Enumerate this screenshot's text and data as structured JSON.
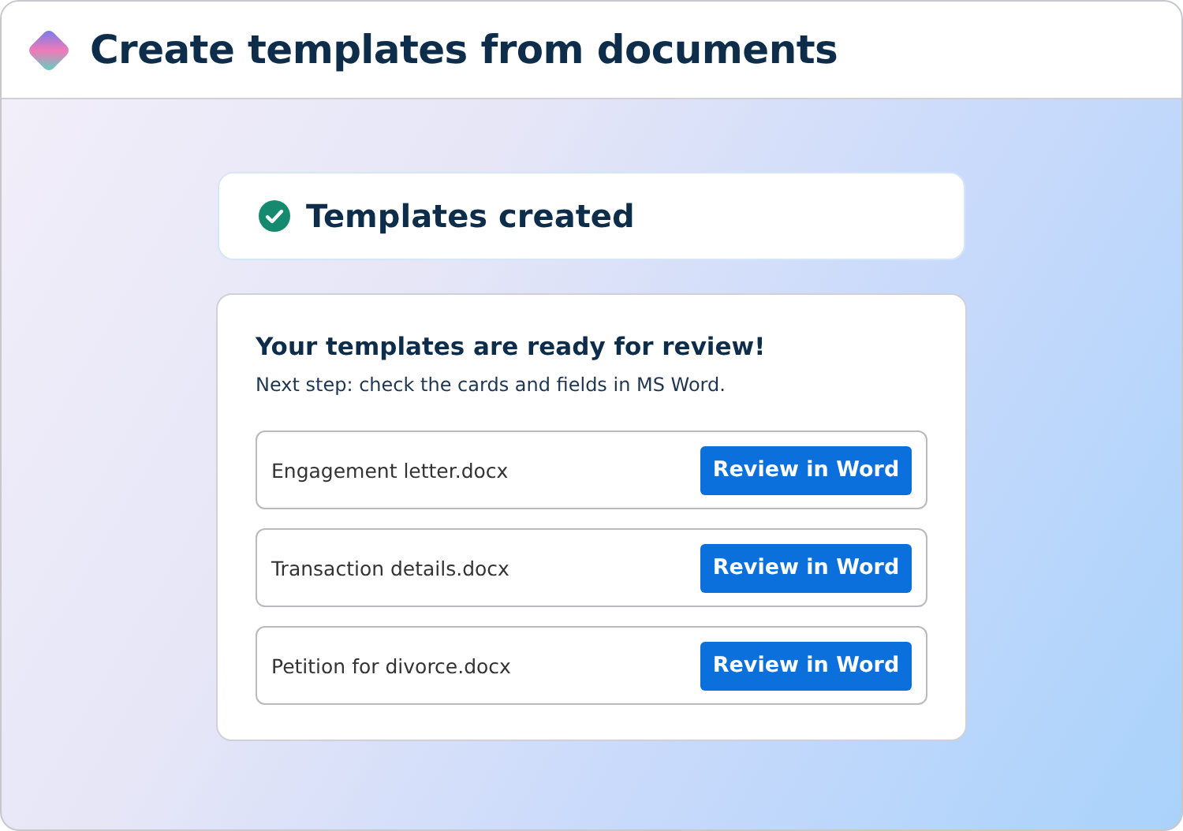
{
  "header": {
    "title": "Create templates from documents"
  },
  "status": {
    "title": "Templates created",
    "done": true
  },
  "panel": {
    "heading": "Your templates are ready for review!",
    "subtitle": "Next step: check the cards and fields in MS Word.",
    "files": [
      {
        "name": "Engagement letter.docx",
        "action": "Review in Word"
      },
      {
        "name": "Transaction details.docx",
        "action": "Review in Word"
      },
      {
        "name": "Petition for divorce.docx",
        "action": "Review in Word"
      }
    ]
  }
}
